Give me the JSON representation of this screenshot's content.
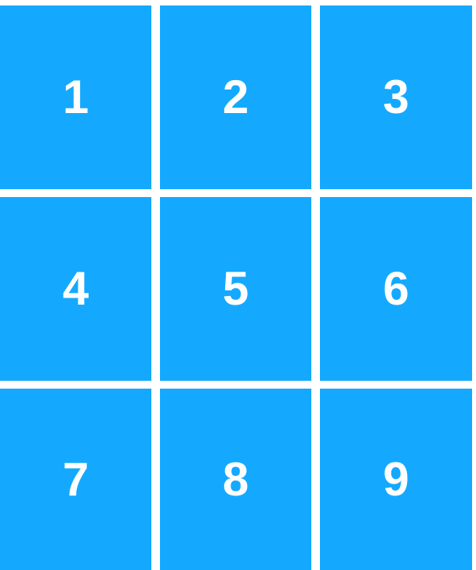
{
  "colors": {
    "tile_background": "#14a9ff",
    "tile_text": "#ffffff",
    "page_background": "#ffffff"
  },
  "tiles": [
    {
      "label": "1"
    },
    {
      "label": "2"
    },
    {
      "label": "3"
    },
    {
      "label": "4"
    },
    {
      "label": "5"
    },
    {
      "label": "6"
    },
    {
      "label": "7"
    },
    {
      "label": "8"
    },
    {
      "label": "9"
    }
  ]
}
